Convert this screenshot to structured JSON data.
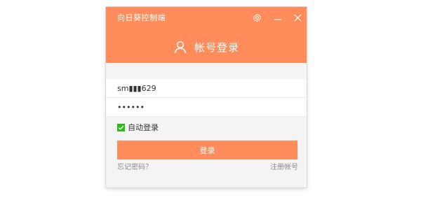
{
  "window": {
    "app_title": "向日葵控制端",
    "heading": "帐号登录"
  },
  "form": {
    "username_value": "sm▮▮▮629",
    "password_value": "••••••",
    "auto_login_label": "自动登录",
    "auto_login_checked": true,
    "login_button_label": "登录",
    "forgot_password_link": "忘记密码？",
    "register_link": "注册帐号"
  },
  "icons": {
    "settings": "gear-icon",
    "minimize": "minimize-icon",
    "close": "close-icon",
    "user": "user-icon",
    "checkbox": "checkmark-icon"
  },
  "colors": {
    "accent": "#ff8c5a",
    "checkbox": "#2dbb1a",
    "link": "#8a8a8a"
  }
}
